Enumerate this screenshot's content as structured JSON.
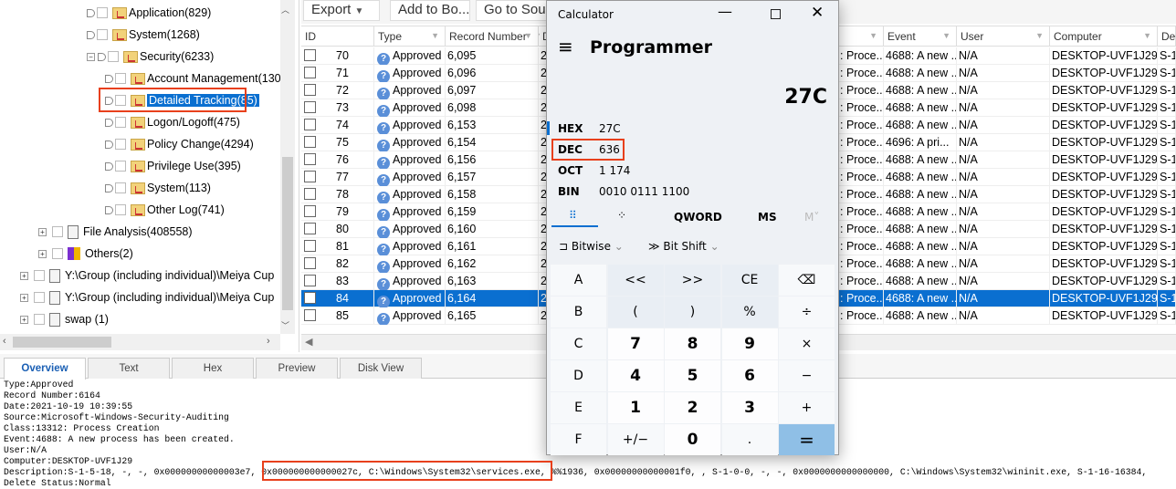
{
  "tree": {
    "items": [
      {
        "label": "Application(829)",
        "indent": 2,
        "kind": "log"
      },
      {
        "label": "System(1268)",
        "indent": 2,
        "kind": "log"
      },
      {
        "label": "Security(6233)",
        "indent": 2,
        "kind": "log",
        "expanded": true
      },
      {
        "label": "Account Management(130)",
        "indent": 3,
        "kind": "log"
      },
      {
        "label": "Detailed Tracking(85)",
        "indent": 3,
        "kind": "log",
        "selected": true
      },
      {
        "label": "Logon/Logoff(475)",
        "indent": 3,
        "kind": "log"
      },
      {
        "label": "Policy Change(4294)",
        "indent": 3,
        "kind": "log"
      },
      {
        "label": "Privilege Use(395)",
        "indent": 3,
        "kind": "log"
      },
      {
        "label": "System(113)",
        "indent": 3,
        "kind": "log"
      },
      {
        "label": "Other Log(741)",
        "indent": 3,
        "kind": "log"
      },
      {
        "label": "File Analysis(408558)",
        "indent": 1,
        "kind": "file"
      },
      {
        "label": "Others(2)",
        "indent": 1,
        "kind": "others"
      },
      {
        "label": "Y:\\Group (including individual)\\Meiya Cup",
        "indent": 0,
        "kind": "doc"
      },
      {
        "label": "Y:\\Group (including individual)\\Meiya Cup",
        "indent": 0,
        "kind": "doc"
      },
      {
        "label": "swap (1)",
        "indent": 0,
        "kind": "doc"
      }
    ]
  },
  "toolbar": {
    "export": "Export",
    "add_bookmark": "Add to Bo...",
    "go_source": "Go to Sour"
  },
  "table": {
    "columns": [
      "ID",
      "Type",
      "Record Number",
      "D",
      "",
      "Event",
      "User",
      "Computer",
      "De"
    ],
    "rows": [
      {
        "id": "70",
        "type": "Approved",
        "record": "6,095",
        "d": "2",
        "cls": ": Proce...",
        "event": "4688: A new ...",
        "user": "N/A",
        "computer": "DESKTOP-UVF1J29",
        "de": "S-1"
      },
      {
        "id": "71",
        "type": "Approved",
        "record": "6,096",
        "d": "2",
        "cls": ": Proce...",
        "event": "4688: A new ...",
        "user": "N/A",
        "computer": "DESKTOP-UVF1J29",
        "de": "S-1"
      },
      {
        "id": "72",
        "type": "Approved",
        "record": "6,097",
        "d": "2",
        "cls": ": Proce...",
        "event": "4688: A new ...",
        "user": "N/A",
        "computer": "DESKTOP-UVF1J29",
        "de": "S-1"
      },
      {
        "id": "73",
        "type": "Approved",
        "record": "6,098",
        "d": "2",
        "cls": ": Proce...",
        "event": "4688: A new ...",
        "user": "N/A",
        "computer": "DESKTOP-UVF1J29",
        "de": "S-1"
      },
      {
        "id": "74",
        "type": "Approved",
        "record": "6,153",
        "d": "2",
        "cls": ": Proce...",
        "event": "4688: A new ...",
        "user": "N/A",
        "computer": "DESKTOP-UVF1J29",
        "de": "S-1"
      },
      {
        "id": "75",
        "type": "Approved",
        "record": "6,154",
        "d": "2",
        "cls": ": Proce...",
        "event": "4696: A pri...",
        "user": "N/A",
        "computer": "DESKTOP-UVF1J29",
        "de": "S-1"
      },
      {
        "id": "76",
        "type": "Approved",
        "record": "6,156",
        "d": "2",
        "cls": ": Proce...",
        "event": "4688: A new ...",
        "user": "N/A",
        "computer": "DESKTOP-UVF1J29",
        "de": "S-1"
      },
      {
        "id": "77",
        "type": "Approved",
        "record": "6,157",
        "d": "2",
        "cls": ": Proce...",
        "event": "4688: A new ...",
        "user": "N/A",
        "computer": "DESKTOP-UVF1J29",
        "de": "S-1"
      },
      {
        "id": "78",
        "type": "Approved",
        "record": "6,158",
        "d": "2",
        "cls": ": Proce...",
        "event": "4688: A new ...",
        "user": "N/A",
        "computer": "DESKTOP-UVF1J29",
        "de": "S-1"
      },
      {
        "id": "79",
        "type": "Approved",
        "record": "6,159",
        "d": "2",
        "cls": ": Proce...",
        "event": "4688: A new ...",
        "user": "N/A",
        "computer": "DESKTOP-UVF1J29",
        "de": "S-1"
      },
      {
        "id": "80",
        "type": "Approved",
        "record": "6,160",
        "d": "2",
        "cls": ": Proce...",
        "event": "4688: A new ...",
        "user": "N/A",
        "computer": "DESKTOP-UVF1J29",
        "de": "S-1"
      },
      {
        "id": "81",
        "type": "Approved",
        "record": "6,161",
        "d": "2",
        "cls": ": Proce...",
        "event": "4688: A new ...",
        "user": "N/A",
        "computer": "DESKTOP-UVF1J29",
        "de": "S-1"
      },
      {
        "id": "82",
        "type": "Approved",
        "record": "6,162",
        "d": "2",
        "cls": ": Proce...",
        "event": "4688: A new ...",
        "user": "N/A",
        "computer": "DESKTOP-UVF1J29",
        "de": "S-1"
      },
      {
        "id": "83",
        "type": "Approved",
        "record": "6,163",
        "d": "2",
        "cls": ": Proce...",
        "event": "4688: A new ...",
        "user": "N/A",
        "computer": "DESKTOP-UVF1J29",
        "de": "S-1"
      },
      {
        "id": "84",
        "type": "Approved",
        "record": "6,164",
        "d": "2",
        "cls": ": Proce...",
        "event": "4688: A new ...",
        "user": "N/A",
        "computer": "DESKTOP-UVF1J29",
        "de": "S-1",
        "selected": true
      },
      {
        "id": "85",
        "type": "Approved",
        "record": "6,165",
        "d": "2",
        "cls": ": Proce...",
        "event": "4688: A new ...",
        "user": "N/A",
        "computer": "DESKTOP-UVF1J29",
        "de": "S-1"
      }
    ]
  },
  "tabs": [
    "Overview",
    "Text",
    "Hex",
    "Preview",
    "Disk View"
  ],
  "detail": {
    "lines": [
      "Type:Approved",
      "Record Number:6164",
      "Date:2021-10-19 10:39:55",
      "Source:Microsoft-Windows-Security-Auditing",
      "Class:13312: Process Creation",
      "Event:4688: A new process has been created.",
      "User:N/A",
      "Computer:DESKTOP-UVF1J29"
    ],
    "desc_prefix": "Description:S-1-5-18, -, -, 0x00000000000003e7, ",
    "desc_highlight": "0x000000000000027c, C:\\Windows\\System32\\services.exe,",
    "desc_suffix": " %%1936, 0x00000000000001f0, , S-1-0-0, -, -, 0x0000000000000000, C:\\Windows\\System32\\wininit.exe, S-1-16-16384,",
    "last": "Delete Status:Normal"
  },
  "calculator": {
    "title": "Calculator",
    "mode": "Programmer",
    "display": "27C",
    "hex_label": "HEX",
    "hex": "27C",
    "dec_label": "DEC",
    "dec": "636",
    "oct_label": "OCT",
    "oct": "1 174",
    "bin_label": "BIN",
    "bin": "0010 0111 1100",
    "word_size": "QWORD",
    "ms": "MS",
    "mr": "M˅",
    "bitwise": "Bitwise",
    "bitshift": "Bit Shift",
    "keys": [
      [
        "A",
        "<<",
        ">>",
        "CE",
        "⌫"
      ],
      [
        "B",
        "(",
        ")",
        "%",
        "÷"
      ],
      [
        "C",
        "7",
        "8",
        "9",
        "×"
      ],
      [
        "D",
        "4",
        "5",
        "6",
        "−"
      ],
      [
        "E",
        "1",
        "2",
        "3",
        "+"
      ],
      [
        "F",
        "+/−",
        "0",
        ".",
        "="
      ]
    ]
  },
  "colors": {
    "selection": "#0a6fd0",
    "highlight_box": "#e8401c",
    "equals": "#8fbfe6"
  }
}
